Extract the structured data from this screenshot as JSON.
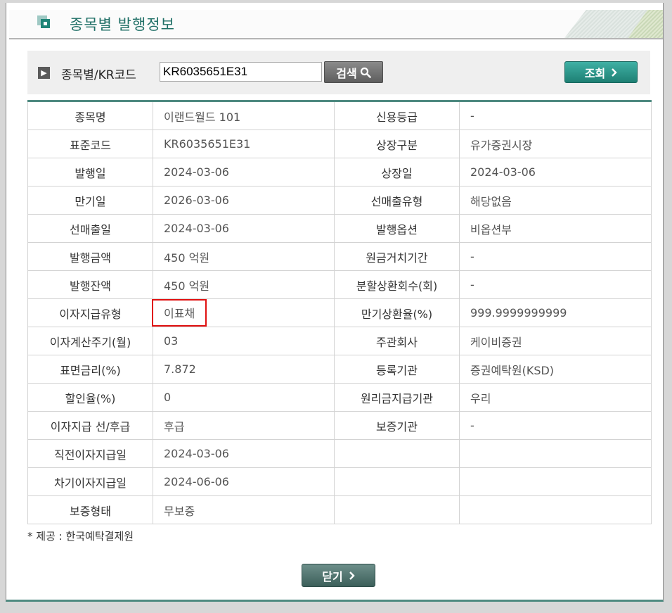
{
  "title": "종목별 발행정보",
  "search": {
    "label": "종목별/KR코드",
    "value": "KR6035651E31",
    "search_button": "검색",
    "inquire_button": "조회"
  },
  "rows": [
    {
      "l1": "종목명",
      "v1": "이랜드월드 101",
      "l2": "신용등급",
      "v2": "-"
    },
    {
      "l1": "표준코드",
      "v1": "KR6035651E31",
      "l2": "상장구분",
      "v2": "유가증권시장"
    },
    {
      "l1": "발행일",
      "v1": "2024-03-06",
      "l2": "상장일",
      "v2": "2024-03-06"
    },
    {
      "l1": "만기일",
      "v1": "2026-03-06",
      "l2": "선매출유형",
      "v2": "해당없음"
    },
    {
      "l1": "선매출일",
      "v1": "2024-03-06",
      "l2": "발행옵션",
      "v2": "비옵션부"
    },
    {
      "l1": "발행금액",
      "v1": "450 억원",
      "l2": "원금거치기간",
      "v2": "-"
    },
    {
      "l1": "발행잔액",
      "v1": "450 억원",
      "l2": "분할상환회수(회)",
      "v2": "-"
    },
    {
      "l1": "이자지급유형",
      "v1": "이표채",
      "l2": "만기상환율(%)",
      "v2": "999.9999999999"
    },
    {
      "l1": "이자계산주기(월)",
      "v1": "03",
      "l2": "주관회사",
      "v2": "케이비증권"
    },
    {
      "l1": "표면금리(%)",
      "v1": "7.872",
      "l2": "등록기관",
      "v2": "증권예탁원(KSD)"
    },
    {
      "l1": "할인율(%)",
      "v1": "0",
      "l2": "원리금지급기관",
      "v2": "우리"
    },
    {
      "l1": "이자지급 선/후급",
      "v1": "후급",
      "l2": "보증기관",
      "v2": "-"
    },
    {
      "l1": "직전이자지급일",
      "v1": "2024-03-06",
      "l2": "",
      "v2": ""
    },
    {
      "l1": "차기이자지급일",
      "v1": "2024-06-06",
      "l2": "",
      "v2": ""
    },
    {
      "l1": "보증형태",
      "v1": "무보증",
      "l2": "",
      "v2": ""
    }
  ],
  "footnote": "* 제공 : 한국예탁결제원",
  "close_button": "닫기",
  "colors": {
    "accent": "#1f8577",
    "highlight_border": "#e01010"
  },
  "icons": [
    "title-square-icon",
    "arrow-right-icon",
    "search-icon",
    "chevron-right-icon"
  ]
}
